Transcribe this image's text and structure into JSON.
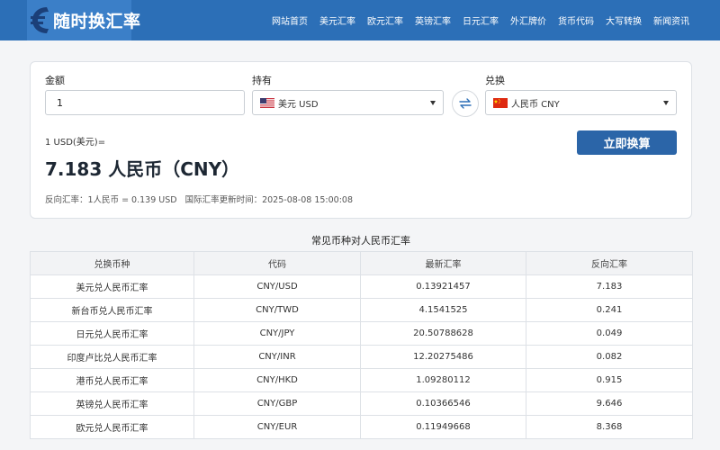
{
  "header": {
    "logo_text": "随时换汇率",
    "nav": [
      "网站首页",
      "美元汇率",
      "欧元汇率",
      "英镑汇率",
      "日元汇率",
      "外汇牌价",
      "货币代码",
      "大写转换",
      "新闻资讯"
    ]
  },
  "converter": {
    "amount_label": "金额",
    "amount_value": "1",
    "from_label": "持有",
    "from_currency": "美元 USD",
    "to_label": "兑换",
    "to_currency": "人民币 CNY",
    "result_line1": "1 USD(美元)=",
    "result_value": "7.183",
    "result_unit": "人民币（CNY）",
    "convert_button": "立即换算",
    "reverse_rate": "反向汇率：1人民币 = 0.139 USD",
    "update_time": "国际汇率更新时间：2025-08-08 15:00:08"
  },
  "table": {
    "title": "常见币种对人民币汇率",
    "headers": [
      "兑换币种",
      "代码",
      "最新汇率",
      "反向汇率"
    ],
    "rows": [
      [
        "美元兑人民币汇率",
        "CNY/USD",
        "0.13921457",
        "7.183"
      ],
      [
        "新台币兑人民币汇率",
        "CNY/TWD",
        "4.1541525",
        "0.241"
      ],
      [
        "日元兑人民币汇率",
        "CNY/JPY",
        "20.50788628",
        "0.049"
      ],
      [
        "印度卢比兑人民币汇率",
        "CNY/INR",
        "12.20275486",
        "0.082"
      ],
      [
        "港币兑人民币汇率",
        "CNY/HKD",
        "1.09280112",
        "0.915"
      ],
      [
        "英镑兑人民币汇率",
        "CNY/GBP",
        "0.10366546",
        "9.646"
      ],
      [
        "欧元兑人民币汇率",
        "CNY/EUR",
        "0.11949668",
        "8.368"
      ]
    ]
  },
  "colors": {
    "header_bg": "#2c6fb7",
    "button_bg": "#2b65a8",
    "swap_icon": "#2c6fb7"
  },
  "icons": {
    "logo": "euro-logo-icon",
    "swap": "swap-arrows-icon",
    "from_flag": "us-flag-icon",
    "to_flag": "cn-flag-icon",
    "dropdown": "chevron-down-icon"
  }
}
